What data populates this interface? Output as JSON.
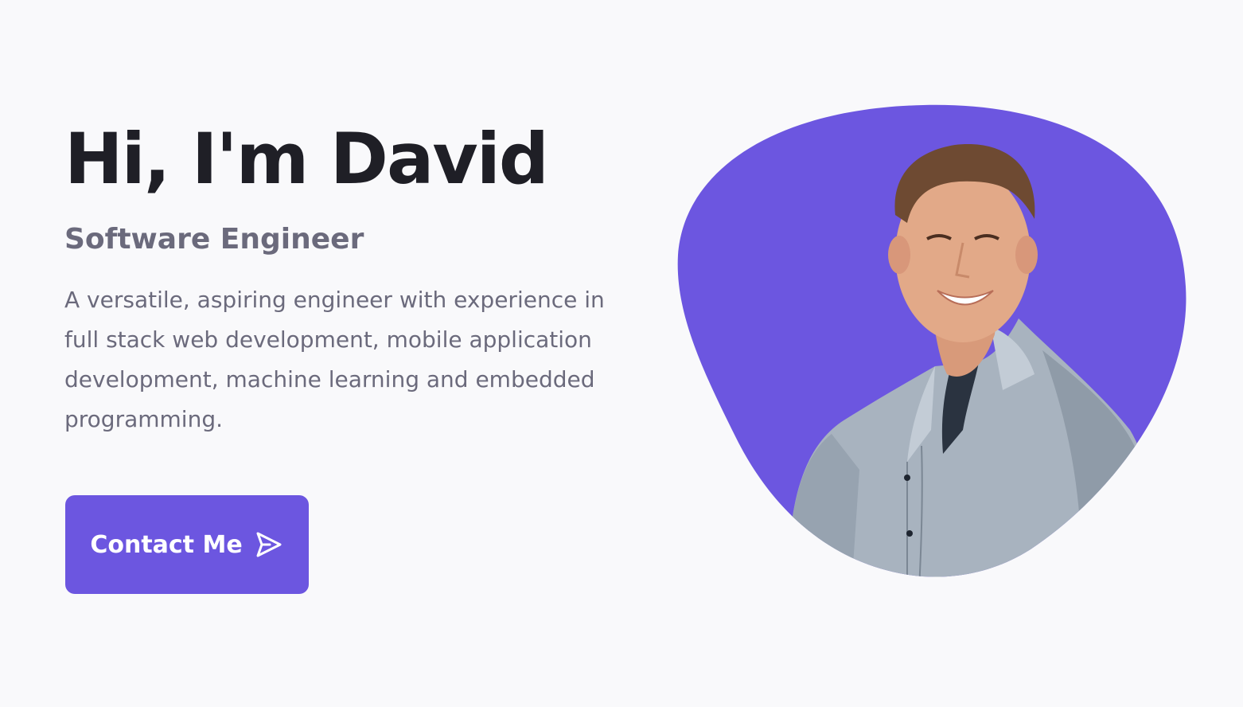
{
  "hero": {
    "title": "Hi, I'm David",
    "subtitle": "Software Engineer",
    "description": "A versatile, aspiring engineer with experience in full stack web development, mobile application development, machine learning and embedded programming."
  },
  "contact_button": {
    "label": "Contact Me",
    "icon": "send-icon"
  },
  "colors": {
    "accent": "#6c56e0",
    "title": "#1f1f26",
    "body_text": "#6b6a7c",
    "background": "#f9f9fb"
  }
}
